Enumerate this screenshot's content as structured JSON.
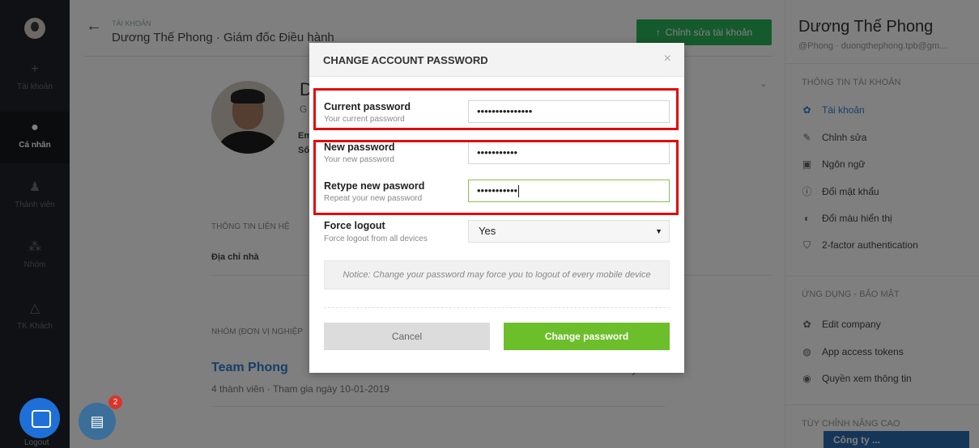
{
  "sidebar": {
    "items": [
      {
        "label": "Tài khoản",
        "icon": "plus-icon"
      },
      {
        "label": "Cá nhân",
        "icon": "user-icon"
      },
      {
        "label": "Thành viên",
        "icon": "members-icon"
      },
      {
        "label": "Nhóm",
        "icon": "group-icon"
      },
      {
        "label": "TK Khách",
        "icon": "triangle-icon"
      }
    ],
    "logout_label": "Logout"
  },
  "header": {
    "breadcrumb": "TÀI KHOẢN",
    "title": "Dương Thế Phong · Giám đốc Điều hành",
    "edit_button": "Chỉnh sửa tài khoản"
  },
  "profile": {
    "name_initial": "D",
    "sub_initial": "G",
    "line1": "Em",
    "line2": "Số"
  },
  "contact": {
    "section_title": "THÔNG TIN LIÊN HỆ",
    "address_label": "Địa chỉ nhà"
  },
  "group": {
    "section_title": "NHÓM (ĐƠN VỊ NGHIỆP",
    "team_name": "Team Phong",
    "team_meta": "4 thành viên · Tham gia ngày 10-01-2019"
  },
  "right_panel": {
    "name": "Dương Thế Phong",
    "handle": "@Phong · duongthephong.tpb@gm...",
    "section_account": "THÔNG TIN TÀI KHOẢN",
    "account_items": [
      {
        "label": "Tài khoản",
        "icon": "gear-icon"
      },
      {
        "label": "Chỉnh sửa",
        "icon": "pencil-icon"
      },
      {
        "label": "Ngôn ngữ",
        "icon": "language-icon"
      },
      {
        "label": "Đổi mật khẩu",
        "icon": "info-icon"
      },
      {
        "label": "Đổi màu hiển thị",
        "icon": "palette-icon"
      },
      {
        "label": "2-factor authentication",
        "icon": "shield-icon"
      }
    ],
    "section_apps": "ỨNG DỤNG - BẢO MẬT",
    "app_items": [
      {
        "label": "Edit company",
        "icon": "gear-icon"
      },
      {
        "label": "App access tokens",
        "icon": "globe-icon"
      },
      {
        "label": "Quyền xem thông tin",
        "icon": "eye-icon"
      }
    ],
    "section_advanced": "TÙY CHỈNH NÂNG CAO",
    "company_chip": "Công ty ..."
  },
  "task_badge_count": "2",
  "modal": {
    "title": "CHANGE ACCOUNT PASSWORD",
    "close": "×",
    "current": {
      "label": "Current password",
      "hint": "Your current password",
      "value": "•••••••••••••••"
    },
    "new": {
      "label": "New password",
      "hint": "Your new password",
      "value": "•••••••••••"
    },
    "retype": {
      "label": "Retype new pasword",
      "hint": "Repeat your new password",
      "value": "•••••••••••"
    },
    "force": {
      "label": "Force logout",
      "hint": "Force logout from all devices",
      "value": "Yes"
    },
    "notice": "Notice: Change your password may force you to logout of every mobile device",
    "cancel": "Cancel",
    "submit": "Change password"
  },
  "colors": {
    "accent_green": "#6cbf2a",
    "highlight_red": "#e30b0b",
    "link_blue": "#2e7fd0"
  }
}
